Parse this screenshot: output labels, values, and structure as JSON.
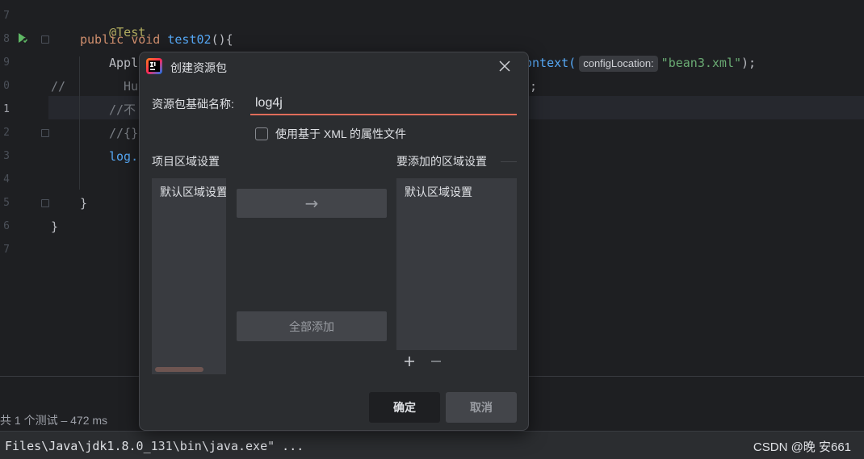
{
  "editor": {
    "line_numbers": [
      "7",
      "8",
      "9",
      "0",
      "1",
      "2",
      "3",
      "4",
      "5",
      "6",
      "7"
    ],
    "lines": {
      "l1_annotation": "@Test",
      "l2_kw1": "public",
      "l2_kw2": "void",
      "l2_method": "test02",
      "l2_rest": "(){",
      "l3_left": "Appl",
      "l3_right": "ontext(",
      "l3_hint": "configLocation:",
      "l3_string": "\"bean3.xml\"",
      "l3_end": ");",
      "l4_comment_marker": "//",
      "l4_left": "Hu",
      "l4_right": ";",
      "l5_comment": "//不",
      "l6_comment": "//{}",
      "l7_left": "log.",
      "l9_brace": "}",
      "l10_brace": "}"
    }
  },
  "run_panel": {
    "status": "共 1 个测试 – 472 ms"
  },
  "console": {
    "text": "Files\\Java\\jdk1.8.0_131\\bin\\java.exe\" ..."
  },
  "watermark": "CSDN @晚 安661",
  "dialog": {
    "title": "创建资源包",
    "base_name_label": "资源包基础名称:",
    "base_name_value": "log4j",
    "checkbox_label": "使用基于 XML 的属性文件",
    "checkbox_checked": false,
    "project_locales_label": "项目区域设置",
    "project_locales_items": [
      "默认区域设置"
    ],
    "locales_to_add_label": "要添加的区域设置",
    "locales_to_add_items": [
      "默认区域设置"
    ],
    "move_button_arrow": "→",
    "add_all_label": "全部添加",
    "ok_label": "确定",
    "cancel_label": "取消"
  },
  "colors": {
    "accent_underline": "#e06c5a",
    "dialog_bg": "#2b2d30",
    "editor_bg": "#1e1f22"
  }
}
